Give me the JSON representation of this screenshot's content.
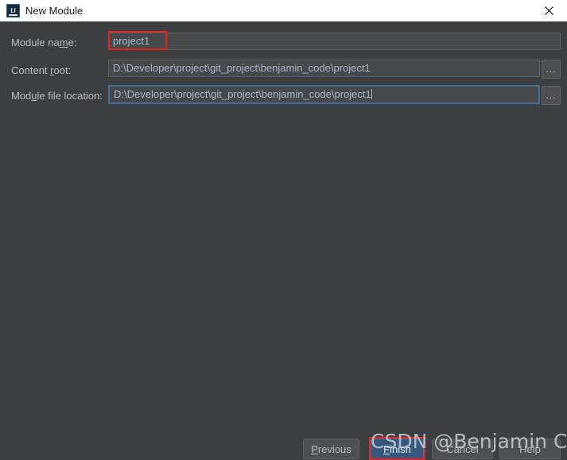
{
  "window": {
    "title": "New Module",
    "icon": "intellij-idea-icon",
    "close_icon": "close-icon",
    "titlebar_bg": "#ffffff",
    "body_bg": "#3c3f41"
  },
  "form": {
    "fields": [
      {
        "label_before": "Module na",
        "label_mnemonic": "m",
        "label_after": "e:",
        "value": "project1",
        "placeholder": "",
        "has_browse": false,
        "focused": false,
        "annotated": true
      },
      {
        "label_before": "Content ",
        "label_mnemonic": "r",
        "label_after": "oot:",
        "value": "D:\\Developer\\project\\git_project\\benjamin_code\\project1",
        "placeholder": "",
        "has_browse": true,
        "focused": false,
        "annotated": false
      },
      {
        "label_before": "Mod",
        "label_mnemonic": "u",
        "label_after": "le file location:",
        "value": "D:\\Developer\\project\\git_project\\benjamin_code\\project1",
        "placeholder": "",
        "has_browse": true,
        "focused": true,
        "annotated": false
      }
    ],
    "browse_label": "..."
  },
  "buttons": [
    {
      "name": "previous",
      "before": "",
      "mnemonic": "P",
      "after": "revious",
      "primary": false,
      "annotated": false
    },
    {
      "name": "finish",
      "before": "",
      "mnemonic": "F",
      "after": "inish",
      "primary": true,
      "annotated": true
    },
    {
      "name": "cancel",
      "before": "Cancel",
      "mnemonic": "",
      "after": "",
      "primary": false,
      "annotated": false
    },
    {
      "name": "help",
      "before": "Help",
      "mnemonic": "",
      "after": "",
      "primary": false,
      "annotated": false
    }
  ],
  "watermark": {
    "text": "CSDN @Benjamin Cheung"
  },
  "colors": {
    "annotation_red": "#e8221f",
    "focus_blue": "#466b9c",
    "primary_button": "#365880"
  }
}
